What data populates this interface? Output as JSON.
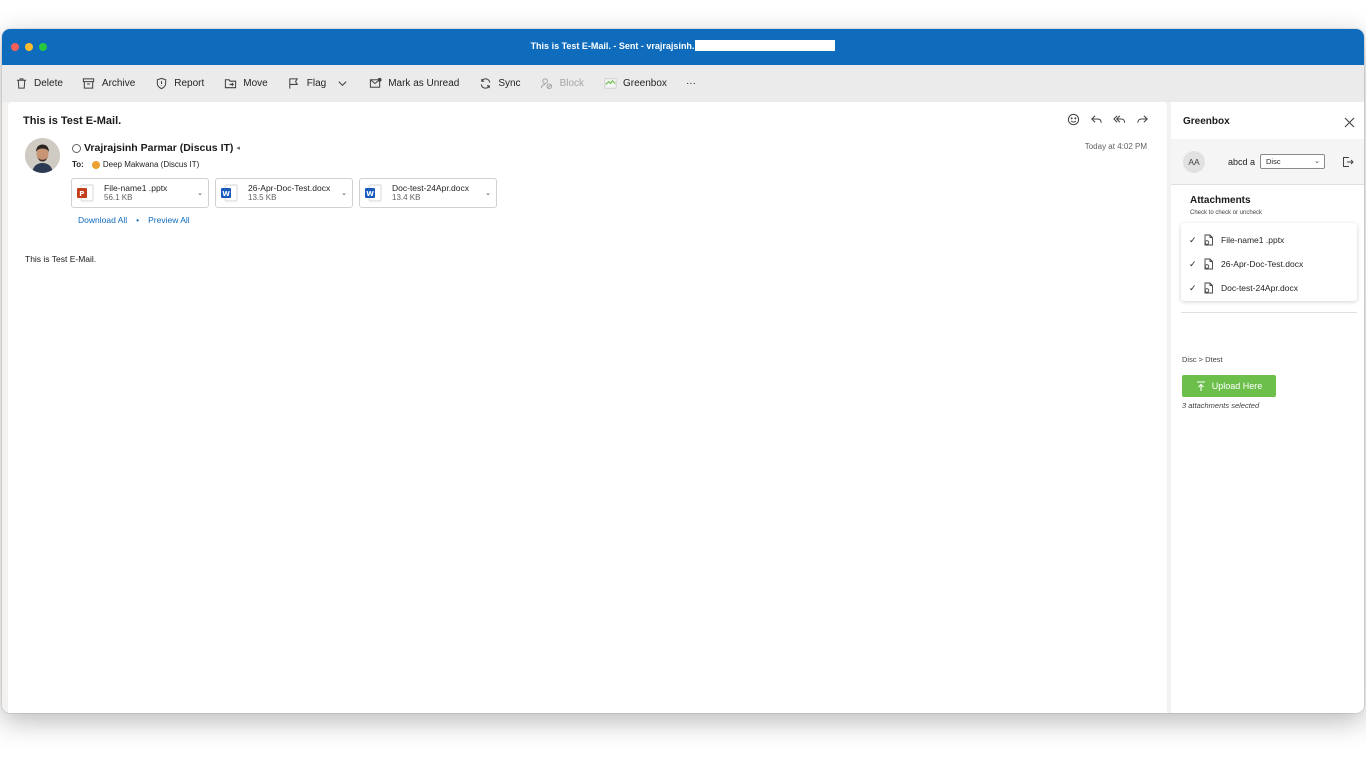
{
  "window": {
    "title": "This is Test E-Mail. - Sent - vrajrajsinh."
  },
  "toolbar": {
    "delete_label": "Delete",
    "archive_label": "Archive",
    "report_label": "Report",
    "move_label": "Move",
    "flag_label": "Flag",
    "mark_unread_label": "Mark as Unread",
    "sync_label": "Sync",
    "block_label": "Block",
    "greenbox_label": "Greenbox",
    "more_label": "···"
  },
  "message": {
    "subject": "This is Test E-Mail.",
    "sender": "Vrajrajsinh Parmar (Discus IT)",
    "to_label": "To:",
    "recipient": "Deep Makwana (Discus IT)",
    "timestamp": "Today at 4:02 PM",
    "body": "This is Test E-Mail.",
    "attachments": [
      {
        "name": "File-name1 .pptx",
        "size": "56.1 KB",
        "type": "pptx"
      },
      {
        "name": "26-Apr-Doc-Test.docx",
        "size": "13.5 KB",
        "type": "docx"
      },
      {
        "name": "Doc-test-24Apr.docx",
        "size": "13.4 KB",
        "type": "docx"
      }
    ],
    "download_all": "Download All",
    "link_separator": "•",
    "preview_all": "Preview All"
  },
  "pane": {
    "title": "Greenbox",
    "user_initials": "AA",
    "user_name": "abcd a",
    "folder_select": "Disc",
    "attachments_title": "Attachments",
    "attachments_hint": "Check to check or uncheck",
    "items": [
      {
        "name": "File-name1 .pptx",
        "checked": true
      },
      {
        "name": "26-Apr-Doc-Test.docx",
        "checked": true
      },
      {
        "name": "Doc-test-24Apr.docx",
        "checked": true
      }
    ],
    "breadcrumb": "Disc > Dtest",
    "upload_label": "Upload Here",
    "selected_note": "3 attachments selected"
  },
  "colors": {
    "titlebar": "#0f6cbd",
    "upload_button": "#6cbf4b",
    "link": "#0f6cbd"
  }
}
